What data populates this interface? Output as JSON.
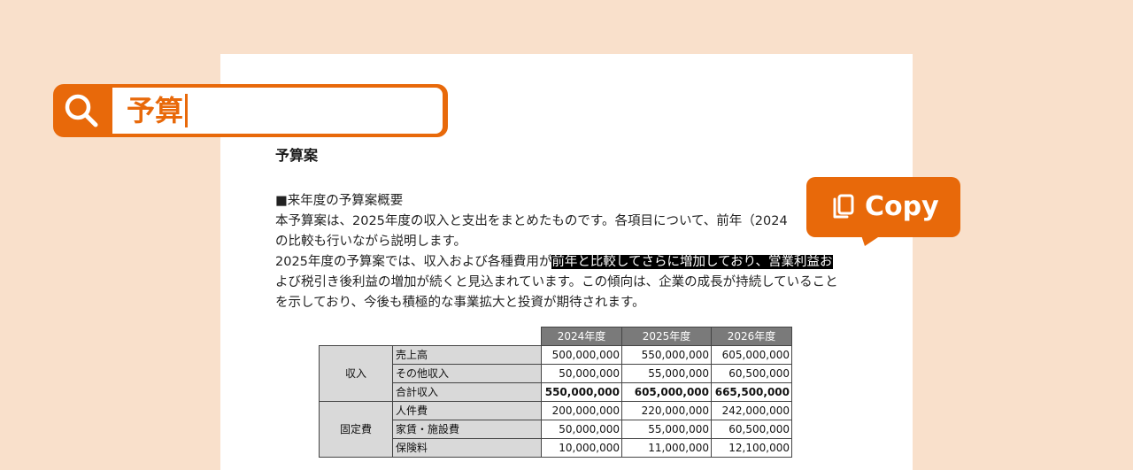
{
  "search": {
    "query": "予算"
  },
  "copy_button": {
    "label": "Copy",
    "icon": "copy-icon"
  },
  "document": {
    "title": "予算案",
    "paragraph_lines": [
      "■来年度の予算案概要",
      "本予算案は、2025年度の収入と支出をまとめたものです。各項目について、前年（2024",
      "の比較も行いながら説明します。"
    ],
    "highlight_line": {
      "before": "2025年度の予算案では、収入および各種費用が",
      "selected": "前年と比較してさらに増加しており、営業利益お"
    },
    "after_lines": [
      "よび税引き後利益の増加が続くと見込まれています。この傾向は、企業の成長が持続していること",
      "を示しており、今後も積極的な事業拡大と投資が期待されます。"
    ],
    "table": {
      "year_headers": [
        "2024年度",
        "2025年度",
        "2026年度"
      ],
      "groups": [
        {
          "category": "収入",
          "rows": [
            {
              "item": "売上高",
              "values": [
                "500,000,000",
                "550,000,000",
                "605,000,000"
              ]
            },
            {
              "item": "その他収入",
              "values": [
                "50,000,000",
                "55,000,000",
                "60,500,000"
              ]
            },
            {
              "item": "合計収入",
              "values": [
                "550,000,000",
                "605,000,000",
                "665,500,000"
              ]
            }
          ]
        },
        {
          "category": "固定費",
          "rows": [
            {
              "item": "人件費",
              "values": [
                "200,000,000",
                "220,000,000",
                "242,000,000"
              ]
            },
            {
              "item": "家賃・施設費",
              "values": [
                "50,000,000",
                "55,000,000",
                "60,500,000"
              ]
            },
            {
              "item": "保険料",
              "values": [
                "10,000,000",
                "11,000,000",
                "12,100,000"
              ]
            }
          ]
        }
      ]
    }
  },
  "colors": {
    "background": "#f9e0cb",
    "accent": "#e8690a",
    "table_header": "#7a7a7a",
    "table_label_bg": "#d9d9d9",
    "selection": "#000000"
  }
}
